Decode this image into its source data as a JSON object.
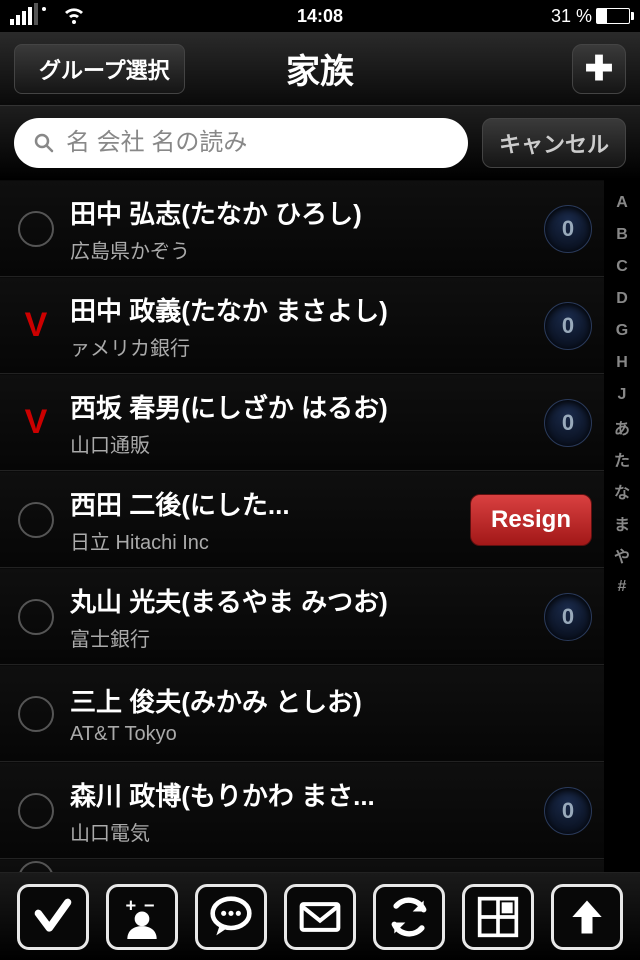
{
  "statusbar": {
    "time": "14:08",
    "battery_pct": "31 %"
  },
  "nav": {
    "back": "グループ選択",
    "title": "家族"
  },
  "search": {
    "placeholder": "名 会社 名の読み",
    "cancel": "キャンセル"
  },
  "contacts": [
    {
      "name": "田中 弘志(たなか ひろし)",
      "sub": "広島県かぞう",
      "selected": false,
      "badge": "0"
    },
    {
      "name": "田中 政義(たなか まさよし)",
      "sub": "ァメリカ銀行",
      "selected": true,
      "badge": "0"
    },
    {
      "name": "西坂 春男(にしざか はるお)",
      "sub": "山口通販",
      "selected": true,
      "badge": "0"
    },
    {
      "name": "西田 二後(にした...",
      "sub": "日立 Hitachi Inc",
      "selected": false,
      "resign": "Resign"
    },
    {
      "name": "丸山 光夫(まるやま みつお)",
      "sub": "富士銀行",
      "selected": false,
      "badge": "0"
    },
    {
      "name": "三上 俊夫(みかみ としお)",
      "sub": "AT&T Tokyo",
      "selected": false
    },
    {
      "name": "森川 政博(もりかわ まさ...",
      "sub": "山口電気",
      "selected": false,
      "badge": "0"
    },
    {
      "name": "",
      "sub": "",
      "selected": false
    }
  ],
  "index": [
    "A",
    "B",
    "C",
    "D",
    "G",
    "H",
    "J",
    "あ",
    "た",
    "な",
    "ま",
    "や",
    "#"
  ],
  "toolbar_names": [
    "select-all",
    "edit-group",
    "sms",
    "mail",
    "sync",
    "grid",
    "scroll-top"
  ]
}
